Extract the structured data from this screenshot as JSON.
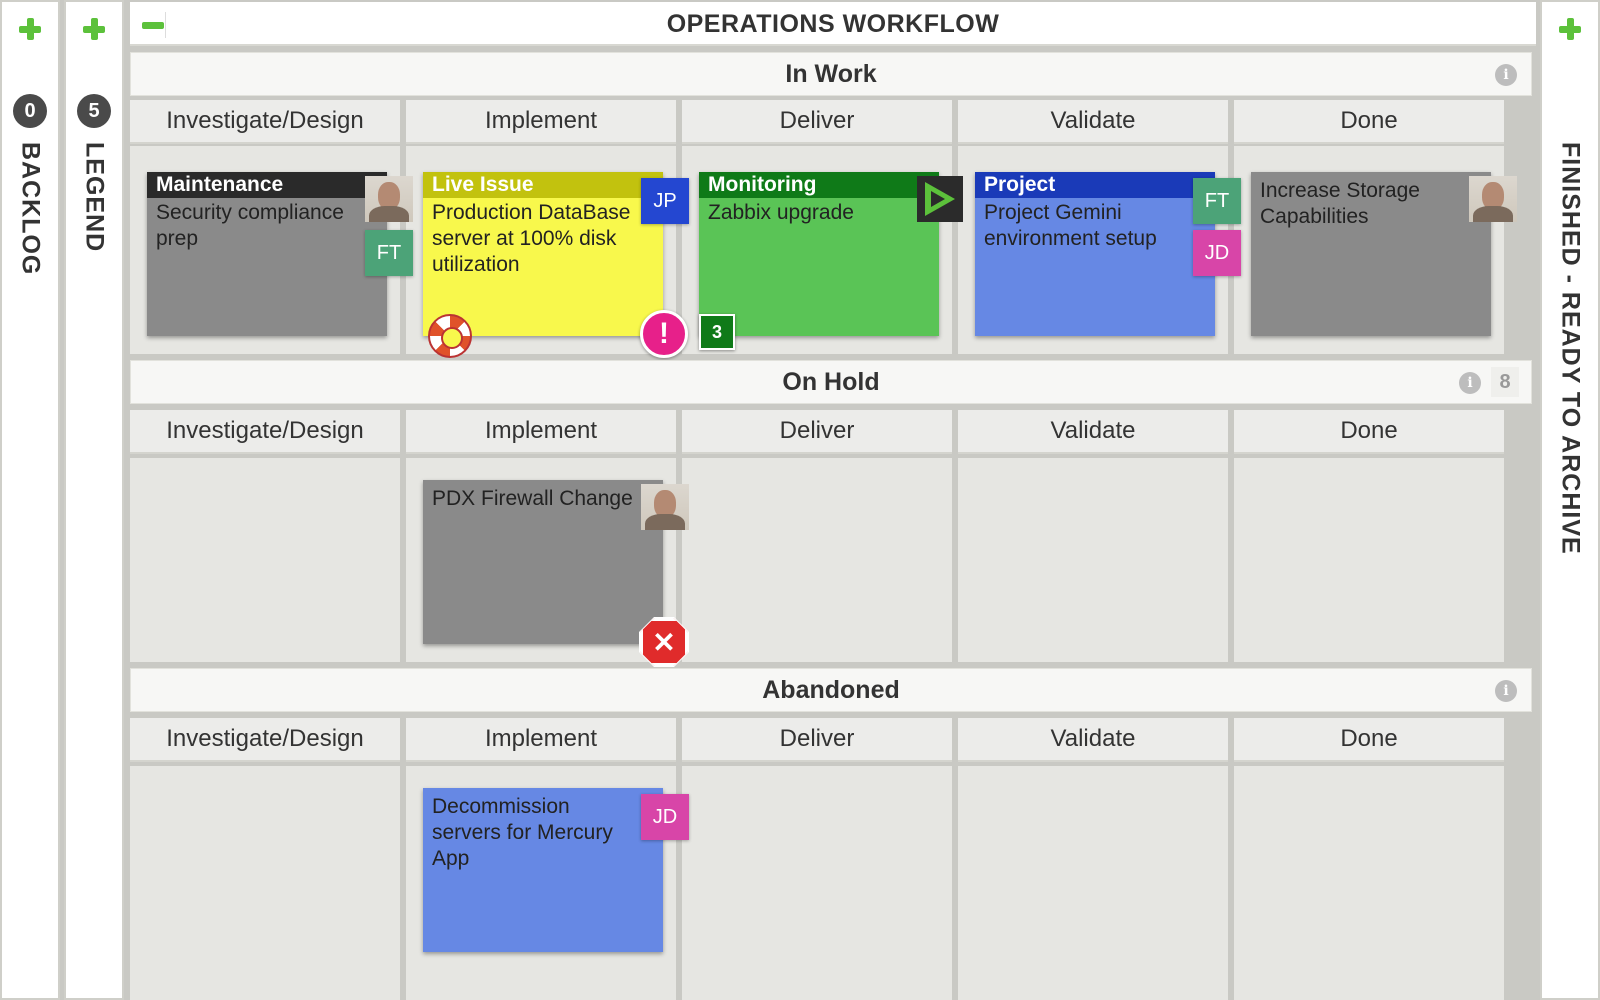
{
  "rails": {
    "backlog": {
      "count": "0",
      "title": "BACKLOG"
    },
    "legend": {
      "count": "5",
      "title": "LEGEND"
    },
    "finished": {
      "title": "FINISHED - READY TO ARCHIVE"
    }
  },
  "board": {
    "title": "OPERATIONS WORKFLOW"
  },
  "lanes": [
    {
      "title": "In Work",
      "columns": [
        "Investigate/Design",
        "Implement",
        "Deliver",
        "Validate",
        "Done"
      ]
    },
    {
      "title": "On Hold",
      "wip_limit": "8",
      "columns": [
        "Investigate/Design",
        "Implement",
        "Deliver",
        "Validate",
        "Done"
      ]
    },
    {
      "title": "Abandoned",
      "columns": [
        "Investigate/Design",
        "Implement",
        "Deliver",
        "Validate",
        "Done"
      ]
    }
  ],
  "cards": {
    "maintenance": {
      "type": "Maintenance",
      "text": "Security compliance prep",
      "initials": "FT",
      "type_color": "#2a2a2a",
      "body_color": "#8a8a8a"
    },
    "live_issue": {
      "type": "Live Issue",
      "text": "Production DataBase server at 100% disk utilization",
      "initials": "JP",
      "type_color": "#c2c20e",
      "body_color": "#f8f84c",
      "alert": "!"
    },
    "monitoring": {
      "type": "Monitoring",
      "text": "Zabbix upgrade",
      "count": "3",
      "type_color": "#0f7a18",
      "body_color": "#5ac456"
    },
    "project": {
      "type": "Project",
      "text": "Project Gemini environment setup",
      "initials_1": "FT",
      "initials_2": "JD",
      "type_color": "#1a3ab8",
      "body_color": "#6688e4"
    },
    "storage": {
      "text": "Increase Storage Capabilities",
      "body_color": "#8a8a8a"
    },
    "firewall": {
      "text": "PDX Firewall Change",
      "blocked": "✕",
      "body_color": "#8a8a8a"
    },
    "decommission": {
      "text": "Decommission servers for Mercury App",
      "initials": "JD",
      "body_color": "#6688e4"
    }
  },
  "initials_colors": {
    "FT": "#4ca378",
    "JP": "#2447d1",
    "JD": "#d845a8"
  },
  "icons": {
    "info": "i"
  }
}
